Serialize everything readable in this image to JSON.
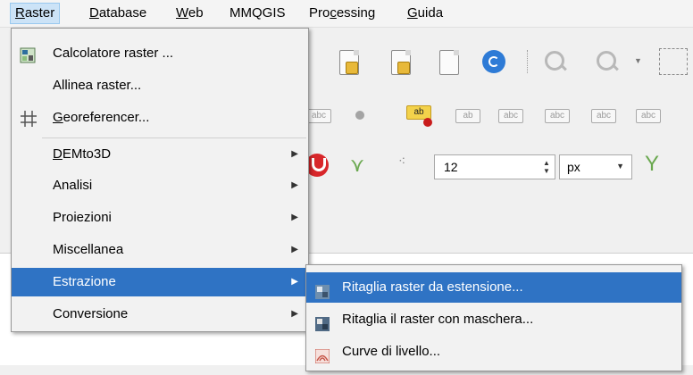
{
  "menubar": {
    "items": [
      {
        "label": "Raster",
        "active": true
      },
      {
        "label": "Database"
      },
      {
        "label": "Web"
      },
      {
        "label": "MMQGIS"
      },
      {
        "label": "Processing"
      },
      {
        "label": "Guida"
      }
    ]
  },
  "raster_menu": {
    "items": [
      {
        "label": "Calcolatore raster ...",
        "icon": "raster-calculator-icon"
      },
      {
        "label": "Allinea raster..."
      },
      {
        "label": "Georeferencer...",
        "icon": "georeferencer-grid-icon"
      },
      {
        "label": "DEMto3D",
        "submenu": true
      },
      {
        "label": "Analisi",
        "submenu": true
      },
      {
        "label": "Proiezioni",
        "submenu": true
      },
      {
        "label": "Miscellanea",
        "submenu": true
      },
      {
        "label": "Estrazione",
        "submenu": true,
        "active": true
      },
      {
        "label": "Conversione",
        "submenu": true
      }
    ]
  },
  "estrazione_submenu": {
    "items": [
      {
        "label": "Ritaglia raster da estensione...",
        "icon": "clip-raster-extent-icon",
        "active": true
      },
      {
        "label": "Ritaglia il raster con maschera...",
        "icon": "clip-raster-mask-icon"
      },
      {
        "label": "Curve di livello...",
        "icon": "contour-icon"
      }
    ]
  },
  "toolbar": {
    "font_size_value": "12",
    "unit_value": "px"
  },
  "colors": {
    "highlight": "#2f73c4",
    "menubar_active": "#cce3f7"
  }
}
